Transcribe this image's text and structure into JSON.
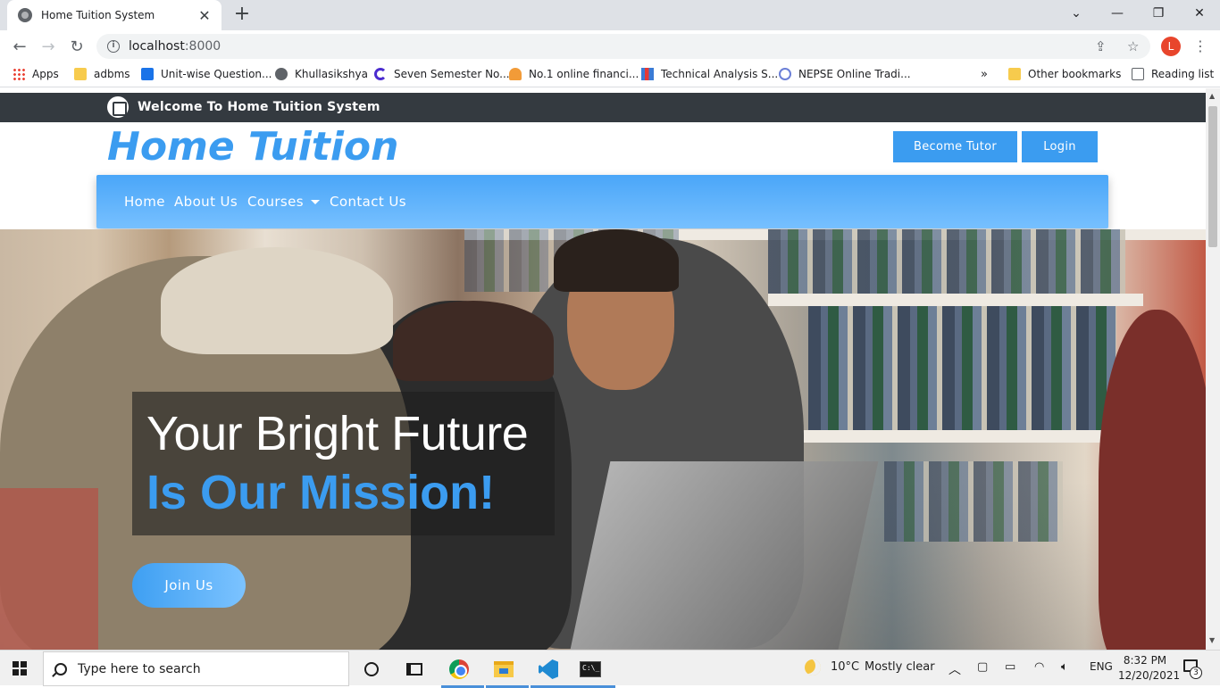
{
  "browser": {
    "tab_title": "Home Tuition System",
    "tab_close": "✕",
    "new_tab": "+",
    "url_host": "localhost",
    "url_port": ":8000",
    "profile_initial": "L",
    "window_controls": [
      "⌄",
      "—",
      "❐",
      "✕"
    ]
  },
  "bookmarks": {
    "items": [
      {
        "label": "Apps",
        "icon": "apps-grid-icon"
      },
      {
        "label": "adbms",
        "icon": "folder-icon"
      },
      {
        "label": "Unit-wise Question...",
        "icon": "site-icon"
      },
      {
        "label": "Khullasikshya",
        "icon": "globe-icon"
      },
      {
        "label": "Seven Semester No...",
        "icon": "c-logo-icon"
      },
      {
        "label": "No.1 online financi...",
        "icon": "finance-icon"
      },
      {
        "label": "Technical Analysis S...",
        "icon": "chart-icon"
      },
      {
        "label": "NEPSE Online Tradi...",
        "icon": "nepse-icon"
      }
    ],
    "overflow": "»",
    "other": "Other bookmarks",
    "reading_list": "Reading list"
  },
  "site": {
    "topbar_welcome": "Welcome To Home Tuition System",
    "brand": "Home Tuition",
    "become_tutor": "Become Tutor",
    "login": "Login",
    "nav": [
      "Home",
      "About Us",
      "Courses",
      "Contact Us"
    ],
    "hero_line1": "Your Bright Future",
    "hero_line2": "Is Our Mission!",
    "join_button": "Join Us"
  },
  "taskbar": {
    "search_placeholder": "Type here to search",
    "weather_temp": "10°C",
    "weather_text": "Mostly clear",
    "language": "ENG",
    "time": "8:32 PM",
    "date": "12/20/2021",
    "notification_count": "3"
  },
  "colors": {
    "accent": "#3b9cf0",
    "topbar": "#343a40",
    "nav_gradient_start": "#4aa6f8",
    "nav_gradient_end": "#77c0ff"
  }
}
